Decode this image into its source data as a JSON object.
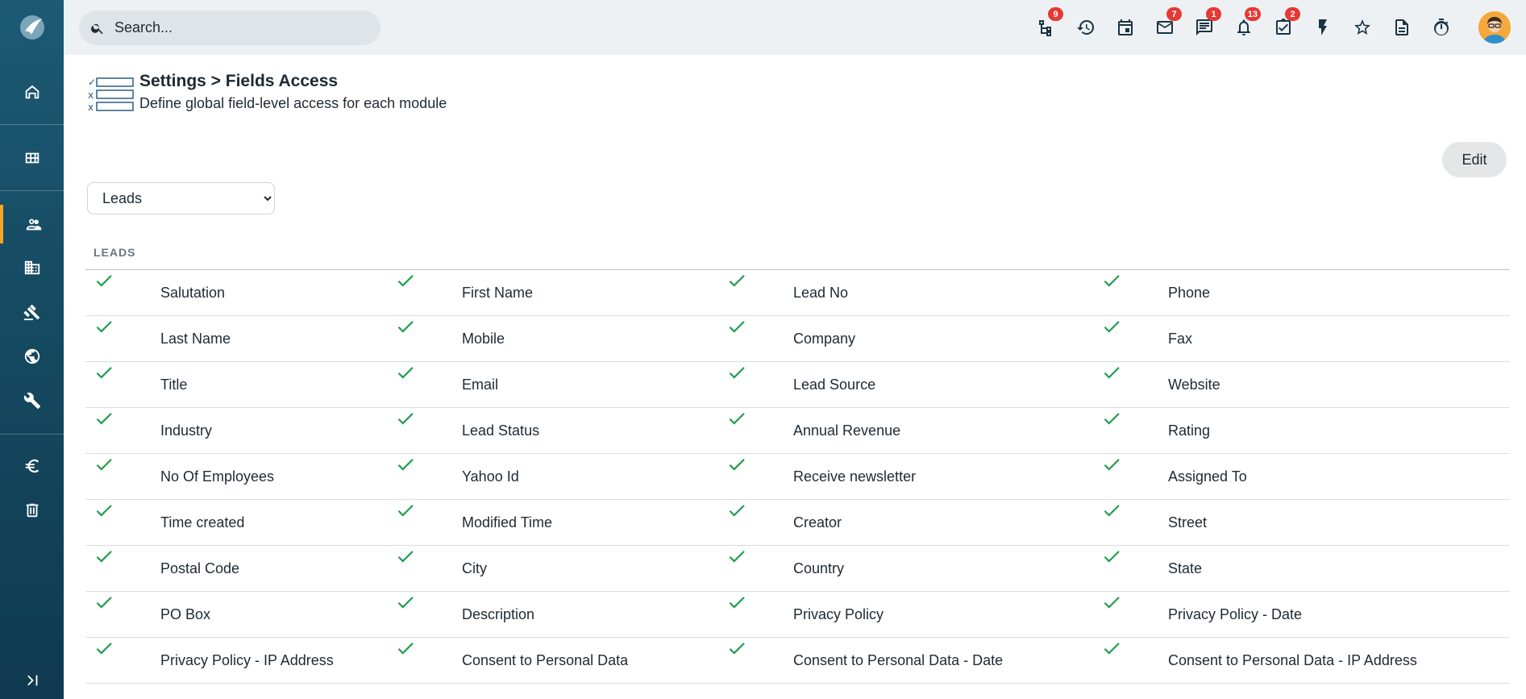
{
  "search": {
    "placeholder": "Search..."
  },
  "topbar": {
    "icons": [
      {
        "name": "workflow-icon",
        "badge": "9"
      },
      {
        "name": "history-icon",
        "badge": ""
      },
      {
        "name": "calendar-icon",
        "badge": ""
      },
      {
        "name": "mail-icon",
        "badge": "7"
      },
      {
        "name": "chat-icon",
        "badge": "1"
      },
      {
        "name": "bell-icon",
        "badge": "13"
      },
      {
        "name": "task-icon",
        "badge": "2"
      },
      {
        "name": "lightning-icon",
        "badge": ""
      },
      {
        "name": "star-icon",
        "badge": ""
      },
      {
        "name": "document-icon",
        "badge": ""
      },
      {
        "name": "timer-icon",
        "badge": ""
      }
    ]
  },
  "page": {
    "title": "Settings > Fields Access",
    "subtitle": "Define global field-level access for each module",
    "edit_label": "Edit",
    "module_selected": "Leads",
    "section_label": "LEADS"
  },
  "fields": [
    [
      "Salutation",
      "First Name",
      "Lead No",
      "Phone"
    ],
    [
      "Last Name",
      "Mobile",
      "Company",
      "Fax"
    ],
    [
      "Title",
      "Email",
      "Lead Source",
      "Website"
    ],
    [
      "Industry",
      "Lead Status",
      "Annual Revenue",
      "Rating"
    ],
    [
      "No Of Employees",
      "Yahoo Id",
      "Receive newsletter",
      "Assigned To"
    ],
    [
      "Time created",
      "Modified Time",
      "Creator",
      "Street"
    ],
    [
      "Postal Code",
      "City",
      "Country",
      "State"
    ],
    [
      "PO Box",
      "Description",
      "Privacy Policy",
      "Privacy Policy - Date"
    ],
    [
      "Privacy Policy - IP Address",
      "Consent to Personal Data",
      "Consent to Personal Data - Date",
      "Consent to Personal Data - IP Address"
    ]
  ],
  "colors": {
    "sidebar": "#1d5a73",
    "accent": "#f5a623",
    "check": "#1f9d4c",
    "badge": "#e53935"
  }
}
